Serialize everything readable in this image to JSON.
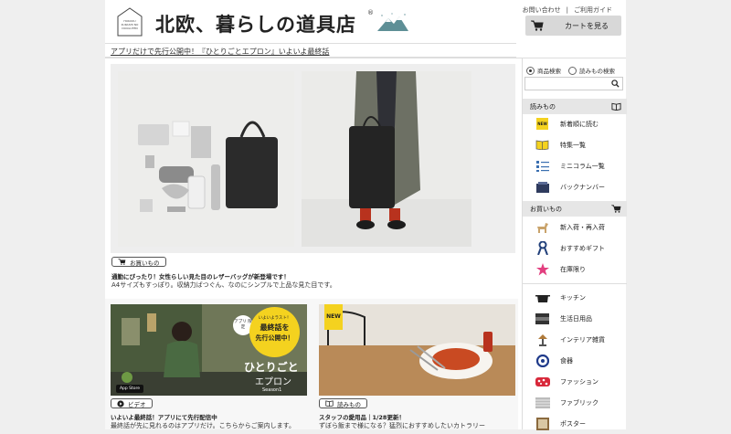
{
  "header": {
    "logo_small": "HOKUOU KURASHI NO DOUGUTEN",
    "logo_title": "北欧、暮らしの道具店",
    "logo_reg": "®",
    "links": [
      "お問い合わせ",
      "ご利用ガイド"
    ],
    "link_sep": "|",
    "cart_label": "カートを見る"
  },
  "announcement": "アプリだけで先行公開中！『ひとりごとエプロン』いよいよ最終話",
  "feature": {
    "tag": "お買いもの",
    "title": "通勤にぴったり！女性らしい見た目のレザーバッグが新登場です！",
    "desc": "A4サイズもすっぽり。収納力ばつぐん、なのにシンプルで上品な見た目です。"
  },
  "cards": [
    {
      "tag": "ビデオ",
      "title": "いよいよ最終話！アプリにて先行配信中",
      "desc": "最終話が先に見れるのはアプリだけ。こちらからご案内します。",
      "overlay": {
        "app_badge": "アプリ 限定",
        "circle_small": "いよいよラスト！",
        "circle_main1": "最終話を",
        "circle_main2": "先行公開中！",
        "title1": "ひとりごと",
        "title2": "エプロン",
        "season": "Season1",
        "store": "App Store"
      }
    },
    {
      "tag": "読みもの",
      "title": "スタッフの愛用品｜1/28更新！",
      "desc": "ずぼら飯まで様になる？猛烈におすすめしたいカトラリー",
      "badge": "NEW"
    }
  ],
  "sidebar": {
    "search_options": [
      "商品検索",
      "読みもの検索"
    ],
    "search_placeholder": "",
    "section_read": "読みもの",
    "read_items": [
      {
        "label": "新着順に読む",
        "icon": "new-icon"
      },
      {
        "label": "特集一覧",
        "icon": "book-icon"
      },
      {
        "label": "ミニコラム一覧",
        "icon": "list-icon"
      },
      {
        "label": "バックナンバー",
        "icon": "archive-icon"
      }
    ],
    "new_icon_text": "NEW",
    "section_shop": "お買いもの",
    "shop_items": [
      {
        "label": "新入荷・再入荷",
        "icon": "horse-icon"
      },
      {
        "label": "おすすめギフト",
        "icon": "ribbon-icon"
      },
      {
        "label": "在庫限り",
        "icon": "star-icon"
      },
      {
        "label": "キッチン",
        "icon": "pot-icon"
      },
      {
        "label": "生活日用品",
        "icon": "towel-icon"
      },
      {
        "label": "インテリア雑貨",
        "icon": "lamp-icon"
      },
      {
        "label": "食器",
        "icon": "plate-icon"
      },
      {
        "label": "ファッション",
        "icon": "fashion-icon"
      },
      {
        "label": "ファブリック",
        "icon": "fabric-icon"
      },
      {
        "label": "ポスター",
        "icon": "poster-icon"
      }
    ]
  },
  "colors": {
    "accent_yellow": "#f4d21f",
    "cart_bg": "#d8d8d8",
    "sidebar_head": "#e6e6e6"
  }
}
